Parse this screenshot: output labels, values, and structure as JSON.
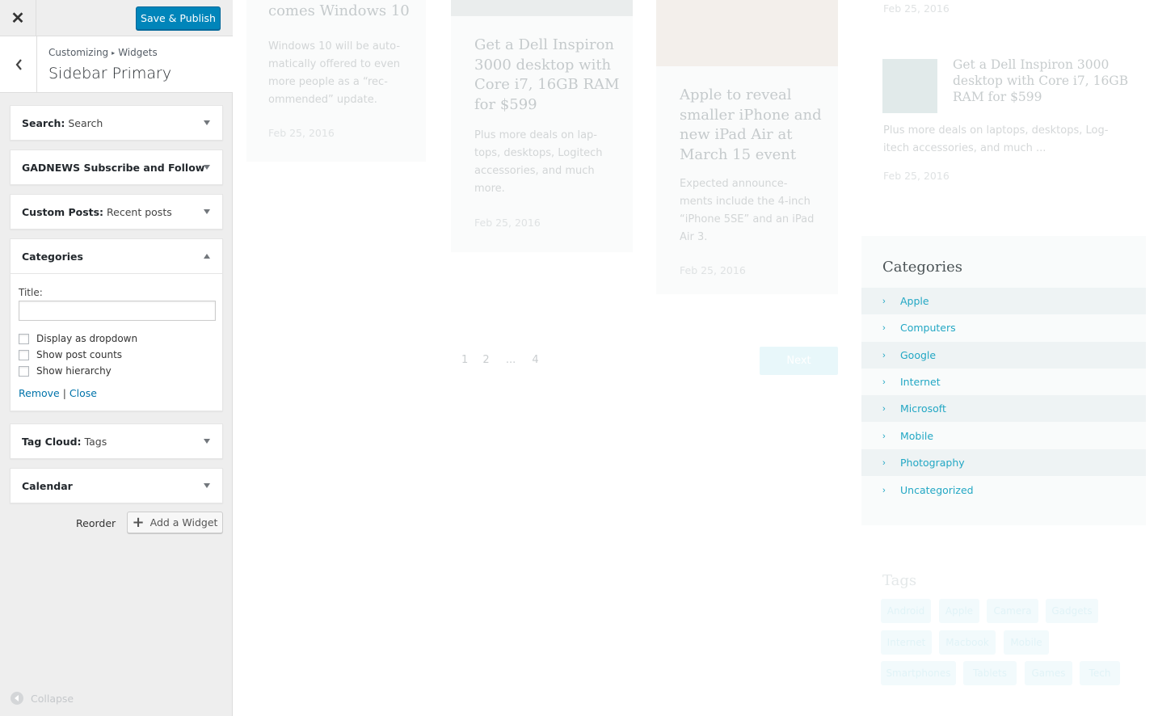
{
  "customizer": {
    "header": {
      "close_icon": "close-icon",
      "save_label": "Save & Publish"
    },
    "section": {
      "breadcrumb_root": "Customizing",
      "breadcrumb_sep": "▸",
      "breadcrumb_current": "Widgets",
      "title": "Sidebar Primary"
    },
    "widgets": [
      {
        "prefix": "Search:",
        "suffix": "Search",
        "expanded": false
      },
      {
        "prefix": "GADNEWS Subscribe and Follow",
        "suffix": "",
        "expanded": false
      },
      {
        "prefix": "Custom Posts:",
        "suffix": "Recent posts",
        "expanded": false
      },
      {
        "prefix": "Categories",
        "suffix": "",
        "expanded": true
      },
      {
        "prefix": "Tag Cloud:",
        "suffix": "Tags",
        "expanded": false
      },
      {
        "prefix": "Calendar",
        "suffix": "",
        "expanded": false
      }
    ],
    "categories_form": {
      "title_label": "Title:",
      "title_value": "",
      "checkboxes": [
        {
          "label": "Display as dropdown",
          "checked": false
        },
        {
          "label": "Show post counts",
          "checked": false
        },
        {
          "label": "Show hierarchy",
          "checked": false
        }
      ],
      "remove_label": "Remove",
      "separator": "|",
      "close_label": "Close"
    },
    "footer": {
      "reorder_label": "Reorder",
      "add_widget_label": "Add a Widget"
    },
    "collapse_label": "Collapse"
  },
  "preview": {
    "posts": [
      {
        "title_lines": [
          "comes Windows 10"
        ],
        "excerpt_lines": [
          "Windows 10 will be auto-",
          "matically offered to even",
          "more people as a “rec-",
          "ommended” update."
        ],
        "date": "Feb 25, 2016"
      },
      {
        "title_lines": [
          "Get a Dell Inspiron",
          "3000 desktop with",
          "Core i7, 16GB RAM",
          "for $599"
        ],
        "excerpt_lines": [
          "Plus more deals on lap-",
          "tops, desktops, Logitech",
          "accessories, and much",
          "more."
        ],
        "date": "Feb 25, 2016"
      },
      {
        "title_lines": [
          "Apple to reveal",
          "smaller iPhone and",
          "new iPad Air at",
          "March 15 event"
        ],
        "excerpt_lines": [
          "Expected announce-",
          "ments include the 4-inch",
          "“iPhone 5SE” and an iPad",
          "Air 3."
        ],
        "date": "Feb 25, 2016"
      }
    ],
    "pagination": {
      "pages": [
        "1",
        "2",
        "...",
        "4"
      ],
      "next_label": "Next"
    },
    "sidebar_post": {
      "top_date": "Feb 25, 2016",
      "title_lines": [
        "Get a Dell Inspiron 3000",
        "desktop with Core i7, 16GB",
        "RAM for $599"
      ],
      "excerpt_lines": [
        "Plus more deals on laptops, desktops, Log-",
        "itech accessories, and much ..."
      ],
      "date": "Feb 25, 2016"
    },
    "categories": {
      "heading": "Categories",
      "items": [
        "Apple",
        "Computers",
        "Google",
        "Internet",
        "Microsoft",
        "Mobile",
        "Photography",
        "Uncategorized"
      ]
    },
    "tags": {
      "heading": "Tags",
      "items": [
        "Android",
        "Apple",
        "Camera",
        "Gadgets",
        "Internet",
        "Macbook",
        "Mobile",
        "Smartphones",
        "Tablets",
        "Games",
        "Tech"
      ]
    },
    "colors": {
      "accent": "#22a7c4",
      "publish_button": "#0085ba",
      "link": "#0073aa"
    }
  }
}
